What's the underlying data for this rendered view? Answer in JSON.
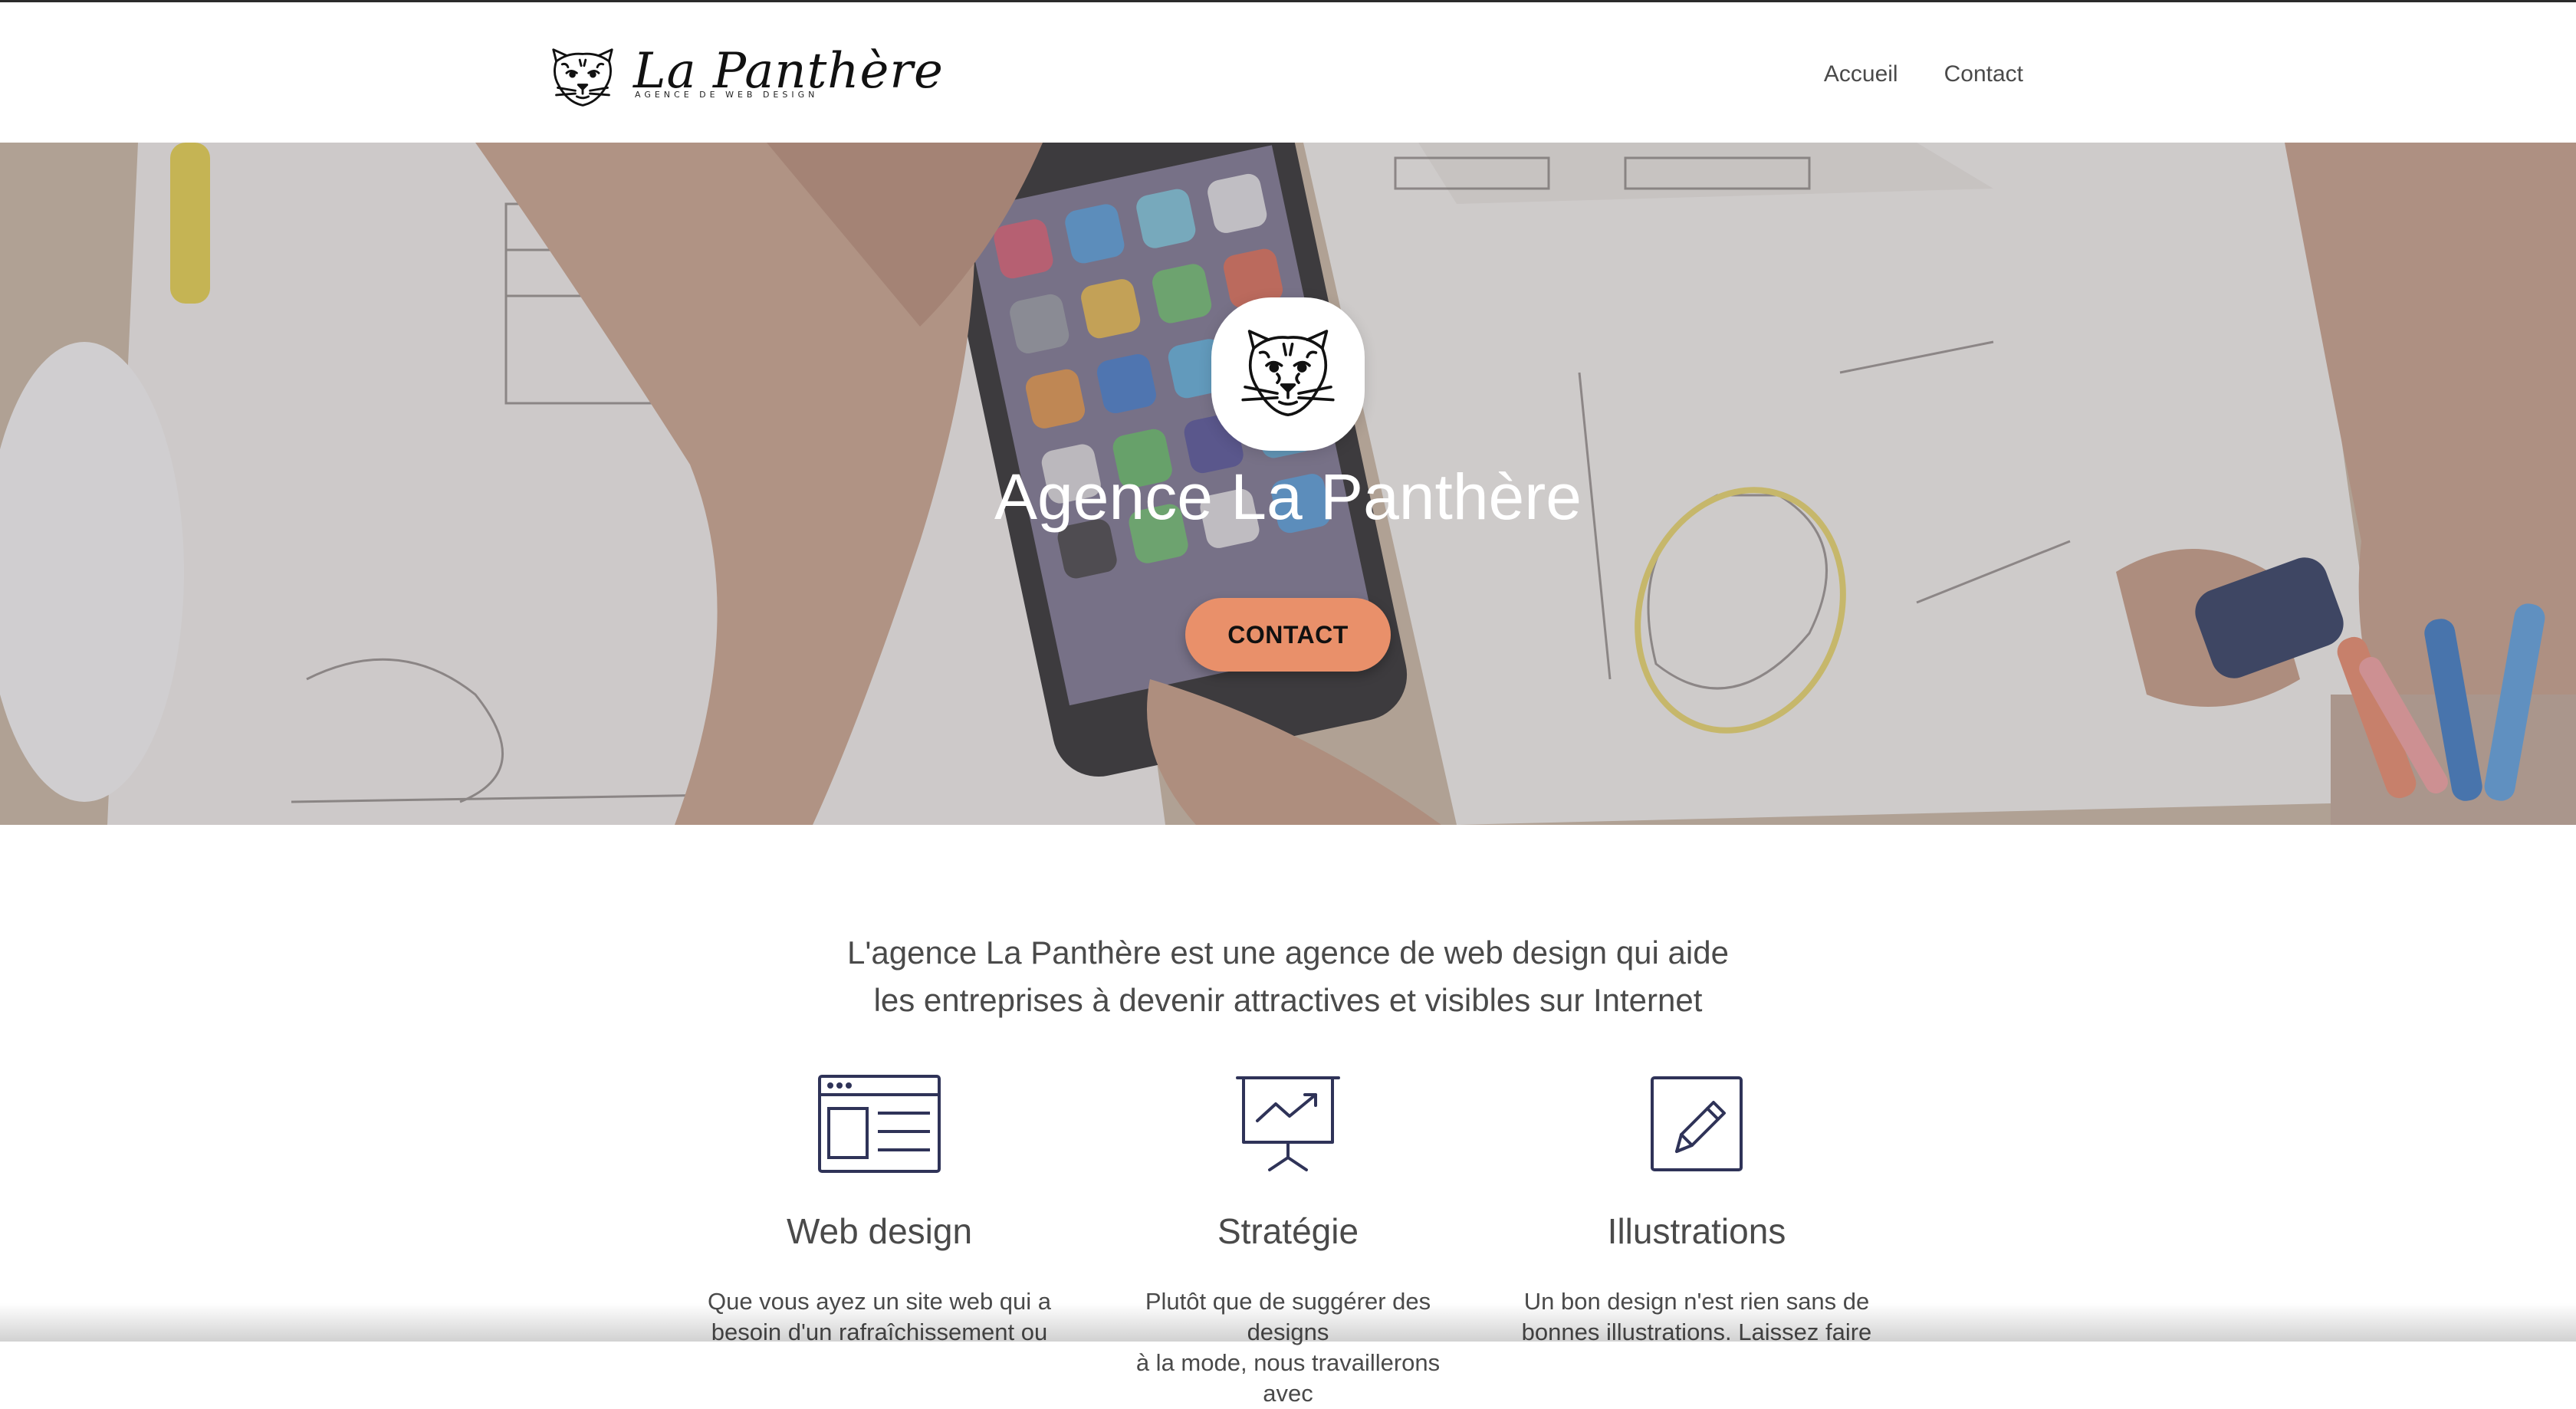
{
  "header": {
    "logo": {
      "title": "La Panthère",
      "tagline": "AGENCE DE WEB DESIGN"
    },
    "nav": [
      {
        "label": "Accueil"
      },
      {
        "label": "Contact"
      }
    ]
  },
  "hero": {
    "title": "Agence La Panthère",
    "cta_label": "CONTACT"
  },
  "intro": {
    "line1": "L'agence La Panthère est une agence de web design qui aide",
    "line2": "les entreprises à devenir attractives et visibles sur Internet"
  },
  "services": [
    {
      "icon": "webpage-layout-icon",
      "title": "Web design",
      "line1": "Que vous ayez un site web qui a",
      "line2": "besoin d'un rafraîchissement ou"
    },
    {
      "icon": "presentation-chart-icon",
      "title": "Stratégie",
      "line1": "Plutôt que de suggérer des designs",
      "line2": "à la mode, nous travaillerons avec"
    },
    {
      "icon": "pencil-icon",
      "title": "Illustrations",
      "line1": "Un bon design n'est rien sans de",
      "line2": "bonnes illustrations. Laissez faire"
    }
  ],
  "colors": {
    "accent": "#e9906a",
    "icon_stroke": "#2f3358",
    "text": "#4a4a4a"
  }
}
